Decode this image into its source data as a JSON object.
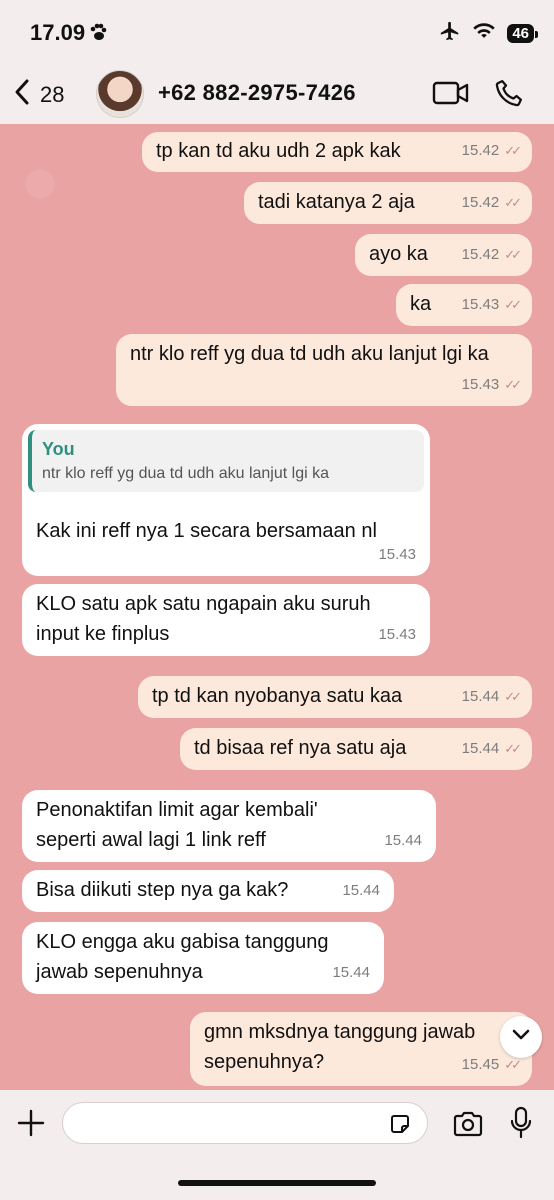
{
  "status_bar": {
    "time": "17.09",
    "battery": "46"
  },
  "header": {
    "back_count": "28",
    "contact_name": "+62 882-2975-7426"
  },
  "messages": [
    {
      "text": "tp kan td aku udh 2 apk kak",
      "time": "15.42",
      "ticks": "✓✓"
    },
    {
      "text": "tadi katanya 2 aja",
      "time": "15.42",
      "ticks": "✓✓"
    },
    {
      "text": "ayo ka",
      "time": "15.42",
      "ticks": "✓✓"
    },
    {
      "text": "ka",
      "time": "15.43",
      "ticks": "✓✓"
    },
    {
      "text": "ntr klo reff yg dua td udh aku lanjut lgi ka",
      "time": "15.43",
      "ticks": "✓✓"
    },
    {
      "quote_author": "You",
      "quote_text": "ntr klo reff yg dua td udh aku lanjut lgi ka",
      "text": "Kak ini reff nya 1 secara bersamaan nl",
      "time": "15.43"
    },
    {
      "text": "KLO satu apk satu ngapain aku suruh input ke finplus",
      "time": "15.43"
    },
    {
      "text": "tp td kan nyobanya satu kaa",
      "time": "15.44",
      "ticks": "✓✓"
    },
    {
      "text": "td bisaa ref nya satu aja",
      "time": "15.44",
      "ticks": "✓✓"
    },
    {
      "text": "Penonaktifan limit agar kembali' seperti awal lagi 1 link reff",
      "time": "15.44"
    },
    {
      "text": "Bisa diikuti step nya ga kak?",
      "time": "15.44"
    },
    {
      "text": "KLO engga aku gabisa tanggung jawab sepenuhnya",
      "time": "15.44"
    },
    {
      "text": "gmn mksdnya tanggung jawab sepenuhnya?",
      "time": "15.45",
      "ticks": "✓✓"
    }
  ],
  "input": {
    "placeholder": ""
  },
  "icons": {
    "back": "chevron-left-icon",
    "video": "video-camera-icon",
    "call": "phone-icon",
    "plus": "plus-icon",
    "sticker": "sticker-icon",
    "camera": "camera-icon",
    "mic": "microphone-icon",
    "scroll": "chevron-down-icon"
  },
  "colors": {
    "chat_bg": "#eaa3a3",
    "outgoing_bubble": "#fde9dc",
    "incoming_bubble": "#ffffff",
    "quote_accent": "#2f8f80"
  }
}
